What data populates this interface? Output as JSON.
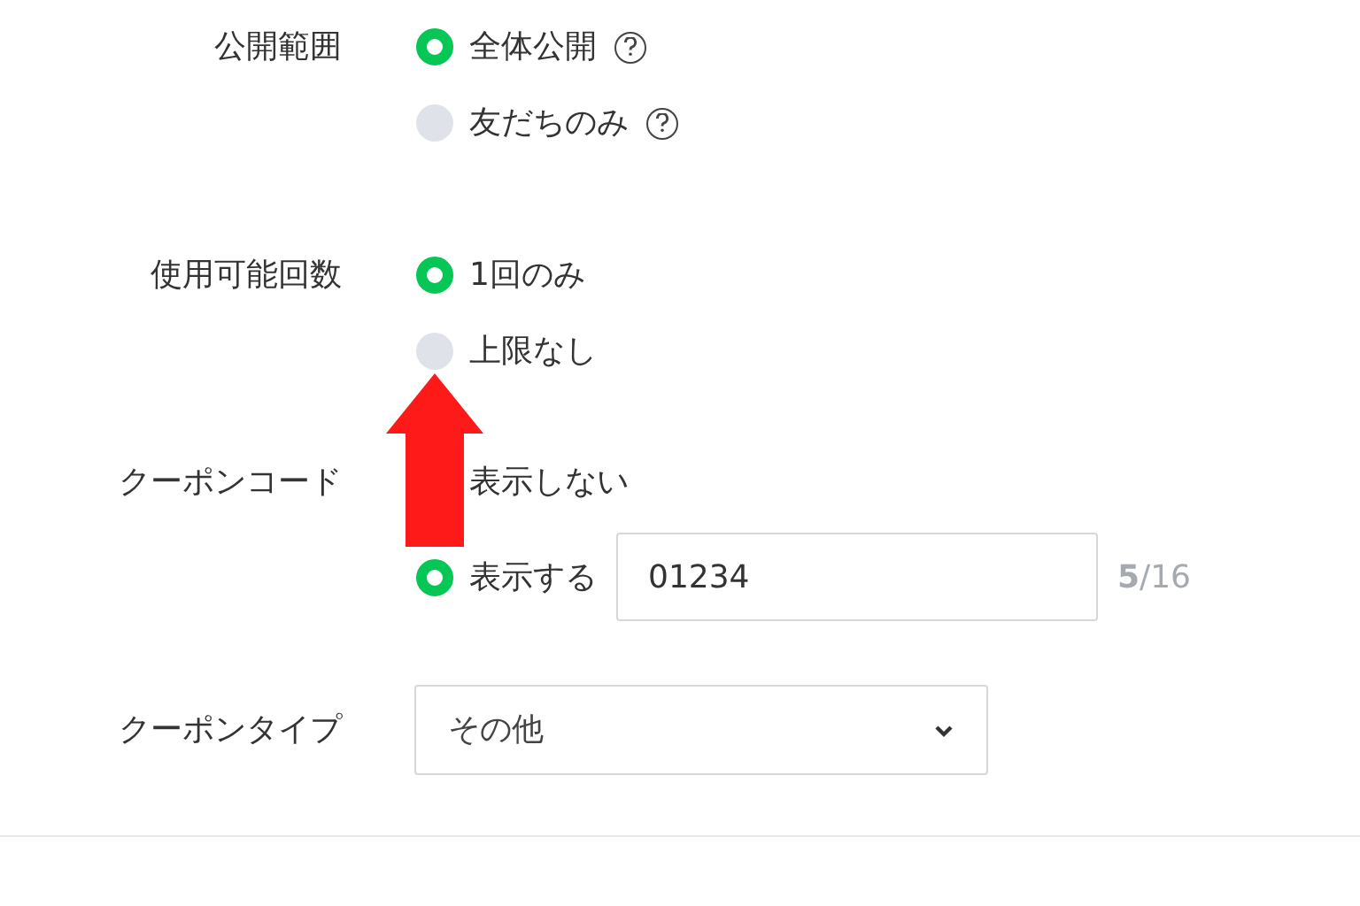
{
  "sections": [
    {
      "label": "公開範囲",
      "options": [
        {
          "label": "全体公開",
          "selected": true,
          "help": true
        },
        {
          "label": "友だちのみ",
          "selected": false,
          "help": true
        }
      ]
    },
    {
      "label": "使用可能回数",
      "options": [
        {
          "label": "1回のみ",
          "selected": true,
          "help": false
        },
        {
          "label": "上限なし",
          "selected": false,
          "help": false
        }
      ]
    },
    {
      "label": "クーポンコード",
      "options": [
        {
          "label": "表示しない",
          "help": false
        },
        {
          "label": "表示する",
          "selected": true,
          "help": false,
          "input": {
            "value": "01234",
            "count": "5",
            "max": "/16"
          }
        }
      ]
    },
    {
      "label": "クーポンタイプ",
      "select": {
        "value": "その他"
      }
    }
  ]
}
